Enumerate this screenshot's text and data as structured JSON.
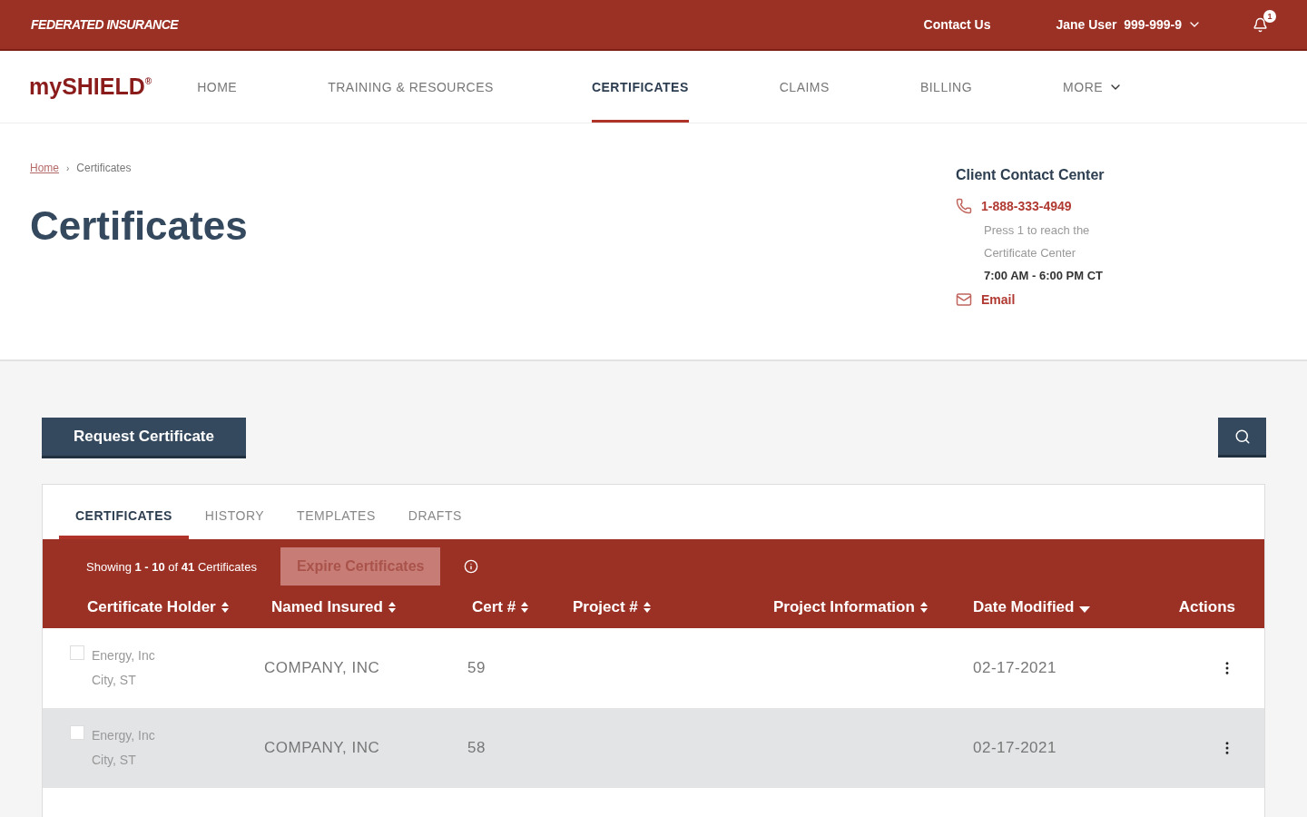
{
  "top_bar": {
    "brand": "FEDERATED INSURANCE",
    "contact": "Contact Us",
    "user": "Jane User",
    "account": "999-999-9",
    "notifications": "1"
  },
  "nav": {
    "logo": "mySHIELD",
    "logo_mark": "®",
    "items": [
      {
        "label": "HOME",
        "selected": false,
        "dropdown": false
      },
      {
        "label": "TRAINING & RESOURCES",
        "selected": false,
        "dropdown": false
      },
      {
        "label": "CERTIFICATES",
        "selected": true,
        "dropdown": false
      },
      {
        "label": "CLAIMS",
        "selected": false,
        "dropdown": false
      },
      {
        "label": "BILLING",
        "selected": false,
        "dropdown": false
      },
      {
        "label": "MORE",
        "selected": false,
        "dropdown": true
      }
    ]
  },
  "breadcrumb": [
    {
      "label": "Home",
      "link": true
    },
    {
      "separator": "›",
      "label": "Certificates",
      "link": false
    }
  ],
  "page_title": "Certificates",
  "contact_center": {
    "title": "Client Contact Center",
    "phone": "1-888-333-4949",
    "lines": [
      "Press 1 to reach the",
      "Certificate Center"
    ],
    "hours": "7:00 AM - 6:00 PM CT",
    "email": "Email"
  },
  "request_button": "Request Certificate",
  "tabs": [
    {
      "label": "CERTIFICATES",
      "selected": true
    },
    {
      "label": "HISTORY",
      "selected": false
    },
    {
      "label": "TEMPLATES",
      "selected": false
    },
    {
      "label": "DRAFTS",
      "selected": false
    }
  ],
  "table": {
    "summary": "Showing **1 - 10** of **41** Certificates",
    "expire_button": {
      "label": "Expire Certificates",
      "disabled": true
    },
    "columns": [
      {
        "label": "Certificate Holder",
        "sortable": true,
        "sorted": false
      },
      {
        "label": "Named Insured",
        "sortable": true,
        "sorted": false
      },
      {
        "label": "Cert #",
        "sortable": true,
        "sorted": false
      },
      {
        "label": "Project #",
        "sortable": true,
        "sorted": false
      },
      {
        "label": "Project Information",
        "sortable": true,
        "sorted": false
      },
      {
        "label": "Date Modified",
        "sortable": true,
        "sorted": true
      },
      {
        "label": "Actions",
        "sortable": false
      }
    ],
    "rows": [
      {
        "holder": "Energy, Inc",
        "location": "City, ST",
        "insured": "COMPANY, INC",
        "cert": "59",
        "date": "02-17-2021",
        "checked": false,
        "highlighted": false
      },
      {
        "holder": "Energy, Inc",
        "location": "City, ST",
        "insured": "COMPANY, INC",
        "cert": "58",
        "date": "02-17-2021",
        "checked": false,
        "highlighted": true
      }
    ]
  }
}
